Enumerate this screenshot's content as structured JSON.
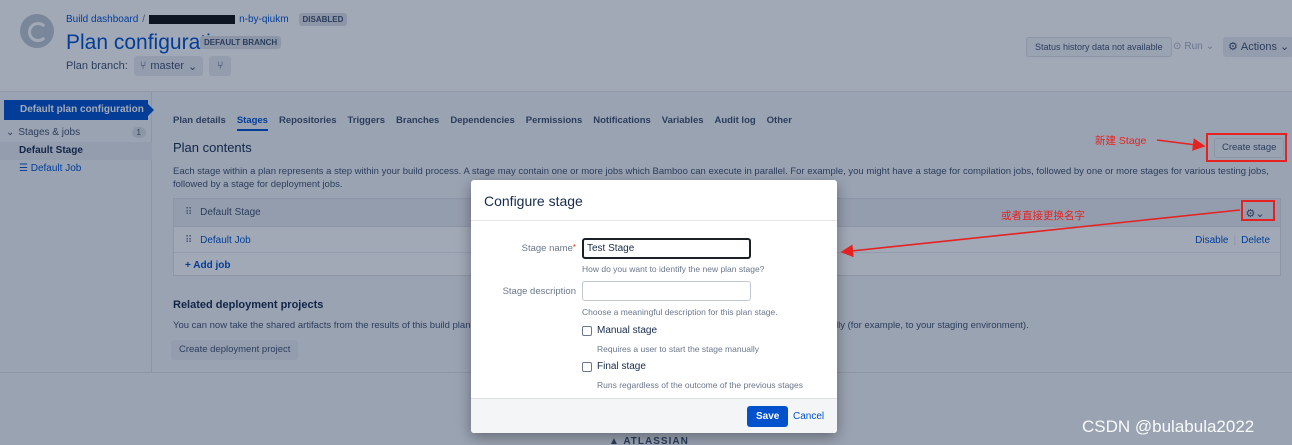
{
  "header": {
    "breadcrumb_root": "Build dashboard",
    "breadcrumb_sep": "/",
    "breadcrumb_plan_suffix": "n-by-qiukm",
    "disabled_badge": "DISABLED",
    "title": "Plan configuration",
    "branch_badge": "DEFAULT BRANCH",
    "plan_branch_label": "Plan branch:",
    "branch_value": "master",
    "status_history": "Status history data not available",
    "run_label": "Run",
    "actions_label": "Actions"
  },
  "sidebar": {
    "active_item": "Default plan configuration",
    "stages_jobs_label": "Stages & jobs",
    "stages_count": "1",
    "stage_label": "Default Stage",
    "job_label": "Default Job"
  },
  "tabs": [
    "Plan details",
    "Stages",
    "Repositories",
    "Triggers",
    "Branches",
    "Dependencies",
    "Permissions",
    "Notifications",
    "Variables",
    "Audit log",
    "Other"
  ],
  "main": {
    "section_title": "Plan contents",
    "create_stage_button": "Create stage",
    "description": "Each stage within a plan represents a step within your build process. A stage may contain one or more jobs which Bamboo can execute in parallel. For example, you might have a stage for compilation jobs, followed by one or more stages for various testing jobs, followed by a stage for deployment jobs.",
    "stage_name": "Default Stage",
    "job_name": "Default Job",
    "disable_link": "Disable",
    "delete_link": "Delete",
    "add_job": "Add job",
    "related_title": "Related deployment projects",
    "related_text": "You can now take the shared artifacts from the results of this build plan.",
    "related_tail": "matically (for example, to your staging environment).",
    "create_deployment_button": "Create deployment project"
  },
  "footer": {
    "atlassian": "ATLASSIAN"
  },
  "modal": {
    "title": "Configure stage",
    "stage_name_label": "Stage name",
    "required_mark": "*",
    "stage_name_value": "Test Stage",
    "stage_name_help": "How do you want to identify the new plan stage?",
    "stage_description_label": "Stage description",
    "stage_description_value": "",
    "stage_description_help": "Choose a meaningful description for this plan stage.",
    "manual_stage_label": "Manual stage",
    "manual_stage_help": "Requires a user to start the stage manually",
    "final_stage_label": "Final stage",
    "final_stage_help": "Runs regardless of the outcome of the previous stages",
    "save_button": "Save",
    "cancel_link": "Cancel"
  },
  "annotations": {
    "create_note": "新建 Stage",
    "rename_note": "或者直接更换名字",
    "color": "#e52222"
  },
  "watermark": "CSDN @bulabula2022"
}
